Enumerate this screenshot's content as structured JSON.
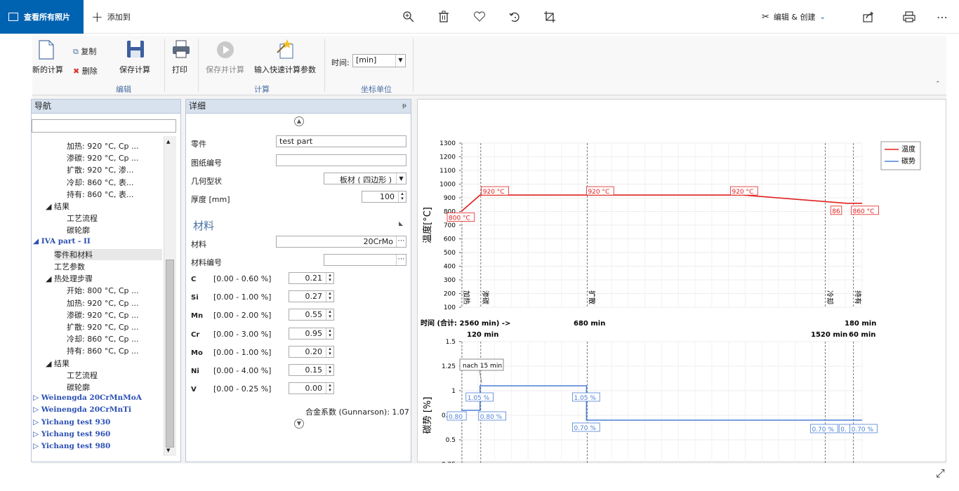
{
  "topbar": {
    "view_all": "查看所有照片",
    "add_to": "添加到",
    "edit_create": "编辑 & 创建",
    "icons": [
      "zoom-in-icon",
      "delete-icon",
      "favorite-heart-icon",
      "rotate-icon",
      "crop-icon",
      "share-icon",
      "print-icon",
      "more-icon"
    ]
  },
  "ribbon": {
    "new_calc": "新的计算",
    "copy": "复制",
    "delete": "删除",
    "save_calc": "保存计算",
    "print": "打印",
    "save_and_calc": "保存并计算",
    "quick_params": "输入快速计算参数",
    "time_label": "时间:",
    "time_unit": "[min]",
    "group_edit": "编辑",
    "group_calc": "计算",
    "group_units": "坐标单位"
  },
  "nav": {
    "title": "导航",
    "search_value": "",
    "rows": [
      {
        "text": "加热: 920 °C, Cp ...",
        "indent": 70,
        "style": "normal"
      },
      {
        "text": "渗碳: 920 °C, Cp ...",
        "indent": 70,
        "style": "normal"
      },
      {
        "text": "扩散: 920 °C, 渗...",
        "indent": 70,
        "style": "normal"
      },
      {
        "text": "冷却: 860 °C, 表...",
        "indent": 70,
        "style": "normal"
      },
      {
        "text": "持有: 860 °C, 表...",
        "indent": 70,
        "style": "normal"
      },
      {
        "text": "◢ 结果",
        "indent": 40,
        "style": "normal"
      },
      {
        "text": "工艺流程",
        "indent": 70,
        "style": "normal"
      },
      {
        "text": "碳轮廓",
        "indent": 70,
        "style": "normal"
      },
      {
        "text": "◢ IVA part - II",
        "indent": 22,
        "style": "bold"
      },
      {
        "text": "零件和材料",
        "indent": 52,
        "style": "selected"
      },
      {
        "text": "工艺参数",
        "indent": 52,
        "style": "normal"
      },
      {
        "text": "◢ 热处理步骤",
        "indent": 40,
        "style": "normal"
      },
      {
        "text": "开始: 800 °C, Cp ...",
        "indent": 70,
        "style": "normal"
      },
      {
        "text": "加热: 920 °C, Cp ...",
        "indent": 70,
        "style": "normal"
      },
      {
        "text": "渗碳: 920 °C, Cp ...",
        "indent": 70,
        "style": "normal"
      },
      {
        "text": "扩散: 920 °C, Cp ...",
        "indent": 70,
        "style": "normal"
      },
      {
        "text": "冷却: 860 °C, Cp ...",
        "indent": 70,
        "style": "normal"
      },
      {
        "text": "持有: 860 °C, Cp ...",
        "indent": 70,
        "style": "normal"
      },
      {
        "text": "◢ 结果",
        "indent": 40,
        "style": "normal"
      },
      {
        "text": "工艺流程",
        "indent": 70,
        "style": "normal"
      },
      {
        "text": "碳轮廓",
        "indent": 70,
        "style": "normal"
      },
      {
        "text": "▷ Weinengda 20CrMnMoA",
        "indent": 22,
        "style": "bold"
      },
      {
        "text": "▷ Weinengda 20CrMnTi",
        "indent": 22,
        "style": "bold"
      },
      {
        "text": "▷ Yichang test 930",
        "indent": 22,
        "style": "bold"
      },
      {
        "text": "▷ Yichang test 960",
        "indent": 22,
        "style": "bold"
      },
      {
        "text": "▷ Yichang test 980",
        "indent": 22,
        "style": "bold"
      }
    ]
  },
  "details": {
    "title": "详细",
    "pin": "ᵽ",
    "part_label": "零件",
    "part_value": "test part",
    "drawing_label": "图纸编号",
    "drawing_value": "",
    "geometry_label": "几何型状",
    "geometry_value": "板材 ( 四边形 )",
    "thickness_label": "厚度 [mm]",
    "thickness_value": "100",
    "material_section": "材料",
    "material_label": "材料",
    "material_value": "20CrMo",
    "material_no_label": "材料编号",
    "material_no_value": "",
    "composition": [
      {
        "el": "C",
        "range": "[0.00 - 0.60 %]",
        "value": "0.21"
      },
      {
        "el": "Si",
        "range": "[0.00 - 1.00 %]",
        "value": "0.27"
      },
      {
        "el": "Mn",
        "range": "[0.00 - 2.00 %]",
        "value": "0.55"
      },
      {
        "el": "Cr",
        "range": "[0.00 - 3.00 %]",
        "value": "0.95"
      },
      {
        "el": "Mo",
        "range": "[0.00 - 1.00 %]",
        "value": "0.20"
      },
      {
        "el": "Ni",
        "range": "[0.00 - 4.00 %]",
        "value": "0.15"
      },
      {
        "el": "V",
        "range": "[0.00 - 0.25 %]",
        "value": "0.00"
      }
    ],
    "alloy_factor": "合金系数 (Gunnarson): 1.07"
  },
  "chart_data": [
    {
      "type": "line",
      "ylabel": "温度[°C]",
      "ylim": [
        100,
        1300
      ],
      "yticks": [
        100,
        200,
        300,
        400,
        500,
        600,
        700,
        800,
        900,
        1000,
        1100,
        1200,
        1300
      ],
      "legend": [
        "温度",
        "碳势"
      ],
      "legend_position": "top-right",
      "series": [
        {
          "name": "温度",
          "color": "#e02020",
          "x": [
            0,
            120,
            120,
            1800,
            1800,
            2460,
            2500,
            2560
          ],
          "y": [
            800,
            920,
            920,
            920,
            920,
            860,
            860,
            860
          ]
        }
      ],
      "data_labels": [
        {
          "text": "800 °C",
          "x": 0,
          "y": 800
        },
        {
          "text": "920 °C",
          "x": 120,
          "y": 920
        },
        {
          "text": "920 °C",
          "x": 800,
          "y": 920
        },
        {
          "text": "920 °C",
          "x": 1800,
          "y": 920
        },
        {
          "text": "86",
          "x": 2440,
          "y": 860
        },
        {
          "text": "860 °C",
          "x": 2500,
          "y": 860
        }
      ],
      "phases": [
        {
          "name": "加热",
          "x": 0
        },
        {
          "name": "渗碳",
          "x": 120
        },
        {
          "name": "扩散",
          "x": 800
        },
        {
          "name": "冷却",
          "x": 2320
        },
        {
          "name": "持有",
          "x": 2500
        }
      ]
    },
    {
      "type": "line",
      "ylabel": "碳势 [%]",
      "ylim": [
        0,
        1.5
      ],
      "yticks": [
        "0",
        "0.25",
        "0.5",
        "0.75",
        "1",
        "1.25",
        "1.5"
      ],
      "series": [
        {
          "name": "碳势",
          "color": "#4d7fd6",
          "x": [
            0,
            120,
            120,
            800,
            800,
            2560
          ],
          "y": [
            0.8,
            0.8,
            1.05,
            1.05,
            0.7,
            0.7
          ]
        }
      ],
      "data_labels": [
        {
          "text": "0.80",
          "x": 0,
          "y": 0.8
        },
        {
          "text": "0.80 %",
          "x": 120,
          "y": 0.8
        },
        {
          "text": "1.05 %",
          "x": 120,
          "y": 1.05
        },
        {
          "text": "1.05 %",
          "x": 800,
          "y": 1.05
        },
        {
          "text": "0.70 %",
          "x": 800,
          "y": 0.7
        },
        {
          "text": "0.70 %",
          "x": 2320,
          "y": 0.7
        },
        {
          "text": "0.",
          "x": 2440,
          "y": 0.7
        },
        {
          "text": "0.70 %",
          "x": 2500,
          "y": 0.7
        }
      ],
      "annotation": "nach 15 min",
      "phases": [
        {
          "name": "加热",
          "x": 0
        },
        {
          "name": "渗碳",
          "x": 120
        },
        {
          "name": "扩散",
          "x": 800
        },
        {
          "name": "冷却",
          "x": 2320
        },
        {
          "name": "持有",
          "x": 2500
        }
      ]
    }
  ],
  "time_summary": {
    "title": "时间 (合计: 2560 min) ->",
    "d120": "120 min",
    "d680": "680 min",
    "d1520": "1520 min",
    "d180": "180 min",
    "d60": "60 min"
  },
  "colors": {
    "accent": "#0063b1",
    "temp": "#e02020",
    "carbon": "#4d7fd6"
  }
}
